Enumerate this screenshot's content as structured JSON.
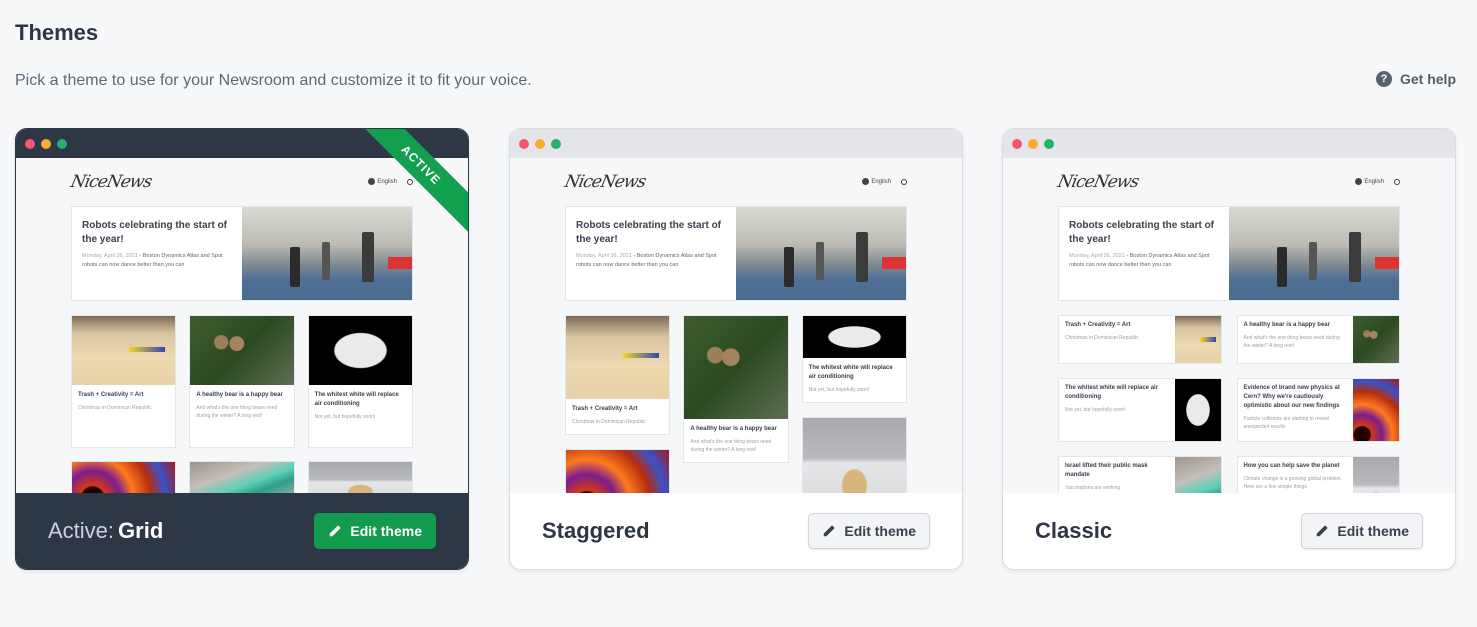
{
  "page": {
    "title": "Themes",
    "subtitle": "Pick a theme to use for your Newsroom and customize it to fit your voice.",
    "help_label": "Get help",
    "help_icon": "question-circle-icon"
  },
  "preview_site": {
    "logo": "NiceNews",
    "language": "English",
    "hero": {
      "title": "Robots celebrating the start of the year!",
      "date": "Monday, April 26, 2021",
      "separator": " - ",
      "desc": "Boston Dynamics Atlas and Spot robots can now dance better than you can"
    },
    "articles": [
      {
        "title": "Trash + Creativity = Art",
        "desc": "Christmas in Dominican Republic"
      },
      {
        "title": "A healthy bear is a happy bear",
        "desc": "And what's the one thing bears need during the winter? A long rest!"
      },
      {
        "title": "The whitest white will replace air conditioning",
        "desc": "Not yet, but hopefully soon!"
      },
      {
        "title": "Evidence of brand new physics at Cern? Why we're cautiously optimistic about our new findings",
        "desc": "Particle collisions are starting to reveal unexpected results"
      },
      {
        "title": "Israel lifted their public mask mandate",
        "desc": "Vaccinations are working"
      },
      {
        "title": "How you can help save the planet",
        "desc": "Climate change is a growing global problem. Here are a few simple things"
      }
    ]
  },
  "themes": [
    {
      "name": "Grid",
      "active": true,
      "active_prefix": "Active:",
      "ribbon": "ACTIVE",
      "edit_label": "Edit theme"
    },
    {
      "name": "Staggered",
      "active": false,
      "edit_label": "Edit theme"
    },
    {
      "name": "Classic",
      "active": false,
      "edit_label": "Edit theme"
    }
  ],
  "colors": {
    "accent_green": "#139b4d",
    "dark_chrome": "#2e3746",
    "dot_red": "#f5566f",
    "dot_yellow": "#f5ab35",
    "dot_green": "#24b26b"
  }
}
